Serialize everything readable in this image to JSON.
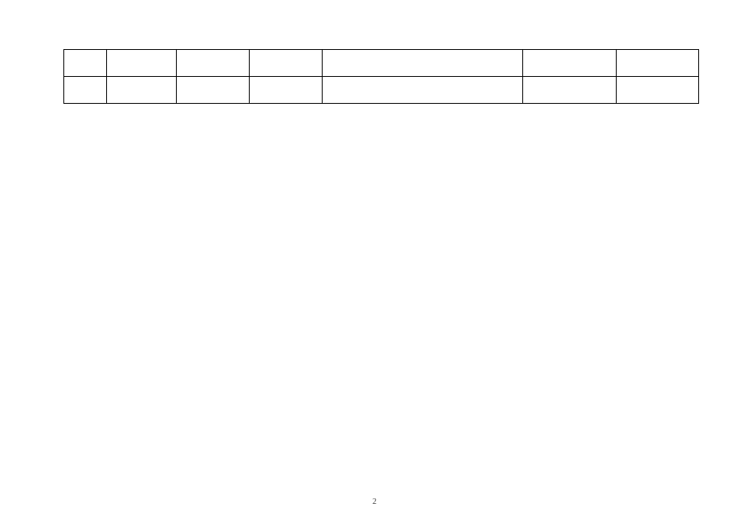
{
  "table": {
    "rows": [
      {
        "cells": [
          "",
          "",
          "",
          "",
          "",
          "",
          ""
        ]
      },
      {
        "cells": [
          "",
          "",
          "",
          "",
          "",
          "",
          ""
        ]
      }
    ]
  },
  "footer": {
    "page_number": "2"
  }
}
